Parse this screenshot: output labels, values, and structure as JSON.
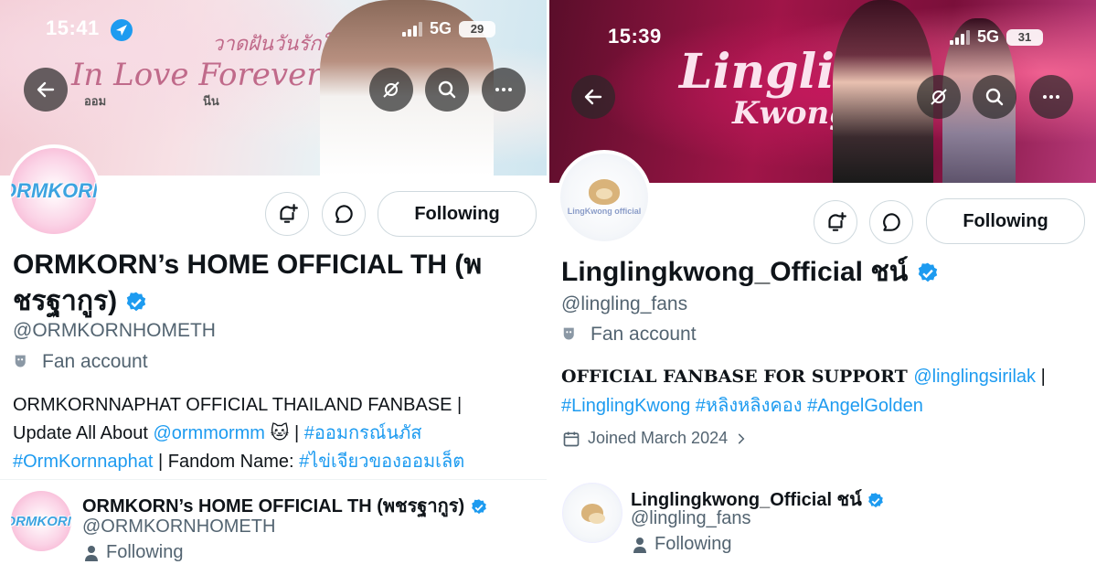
{
  "left": {
    "status": {
      "time": "15:41",
      "network": "5G",
      "battery": "29"
    },
    "banner": {
      "script_title": "In Love Forever",
      "thai_title": "วาดฝันวันรักใหม่",
      "sub": "ออม",
      "sub2": "นีน"
    },
    "avatar_text": "ORMKORN",
    "following_label": "Following",
    "name_line1": "ORMKORN’s HOME OFFICIAL TH (พ",
    "name_line2": "ชรฐากูร)",
    "handle": "@ORMKORNHOMETH",
    "category": "Fan account",
    "bio": {
      "l1": "ORMKORNNAPHAT OFFICIAL THAILAND FANBASE |",
      "l2_a": "Update All About ",
      "l2_link": "@ormmormm",
      "l2_emoji": " 🐱 ",
      "l2_sep": "| ",
      "l2_tag": "#ออมกรณ์นภัส",
      "l3_tag": "#OrmKornnaphat",
      "l3_b": " | Fandom Name: ",
      "l3_tag2": "#ไข่เจียวของออมเล็ต"
    },
    "card": {
      "name": "ORMKORN’s HOME OFFICIAL TH (พชรฐากูร)",
      "handle": "@ORMKORNHOMETH",
      "following": "Following"
    }
  },
  "right": {
    "status": {
      "time": "15:39",
      "network": "5G",
      "battery": "31"
    },
    "banner": {
      "script_title1": "Lingling",
      "script_title2": "Kwong"
    },
    "avatar_text": "LingKwong official",
    "following_label": "Following",
    "name": "Linglingkwong_Official ชน์",
    "handle": "@lingling_fans",
    "category": "Fan account",
    "bio": {
      "a": "OFFICIAL FANBASE FOR SUPPORT ",
      "link": "@linglingsirilak",
      "sep": " |",
      "tag1": "#LinglingKwong",
      "tag2": "#หลิงหลิงคอง",
      "tag3": "#AngelGolden"
    },
    "joined": "Joined March 2024",
    "card": {
      "name": "Linglingkwong_Official ชน์",
      "handle": "@lingling_fans",
      "following": "Following"
    }
  },
  "colors": {
    "link": "#1d9bf0",
    "verified": "#1d9bf0",
    "text": "#0f1419",
    "muted": "#536471"
  }
}
